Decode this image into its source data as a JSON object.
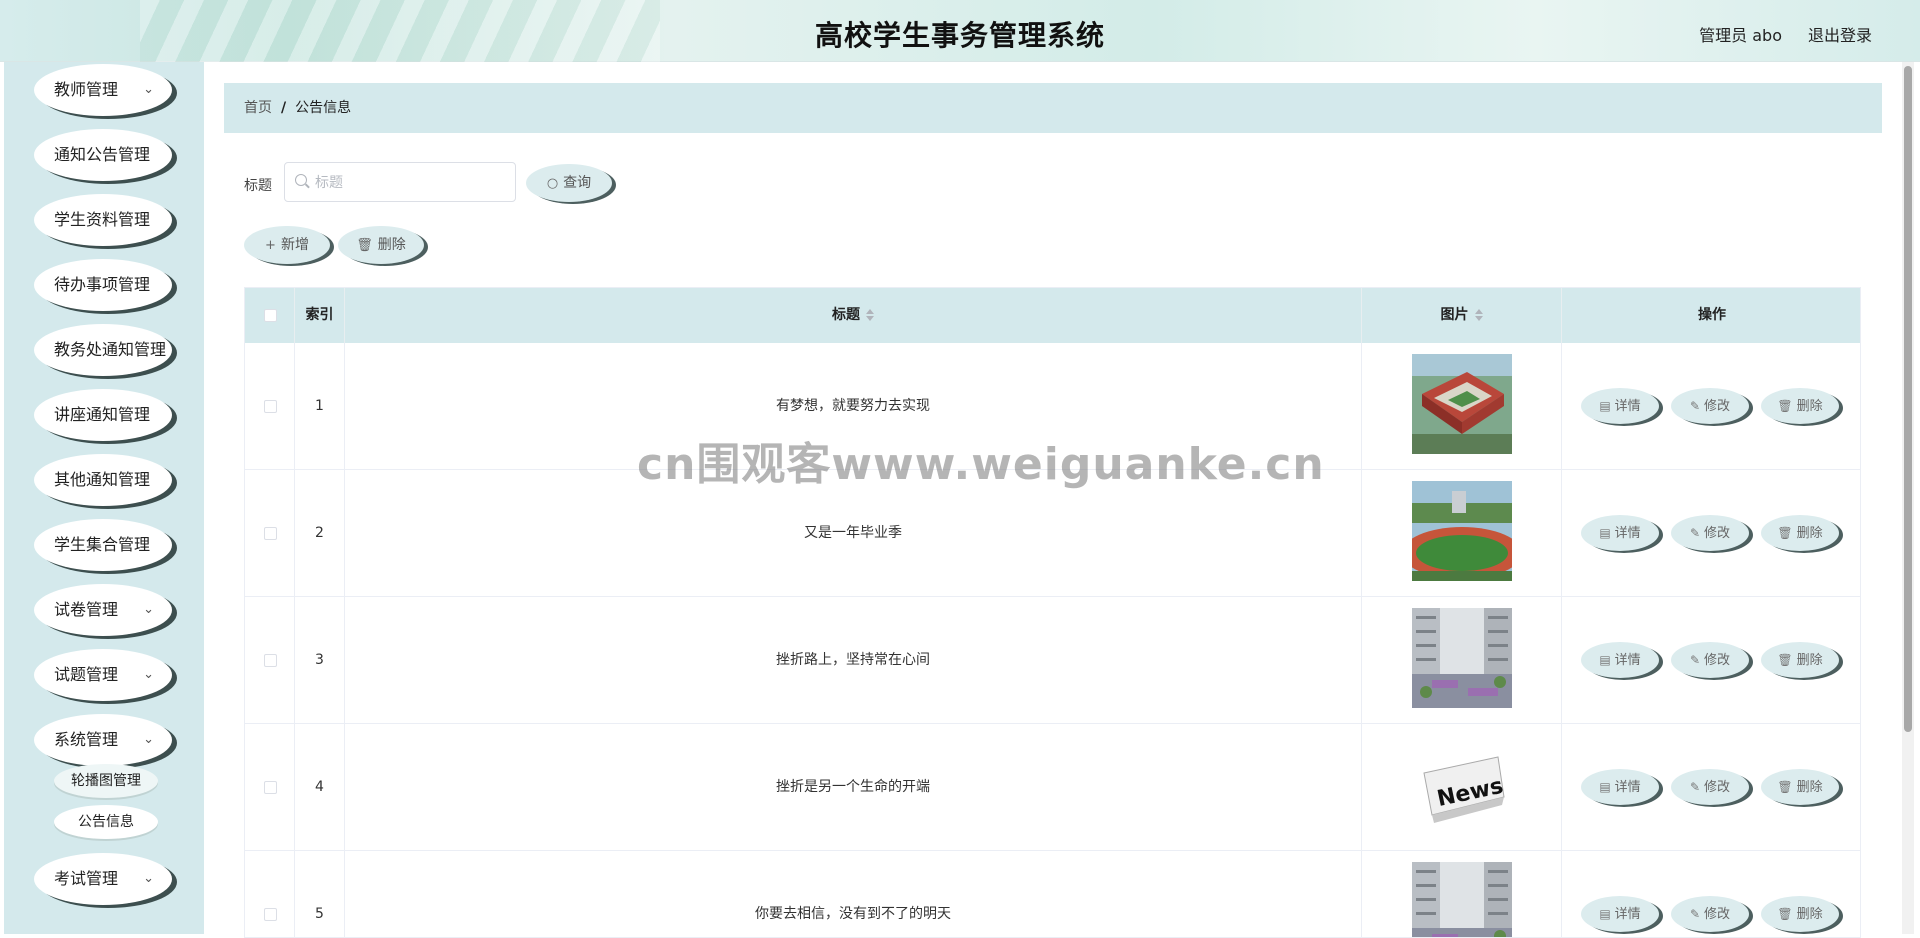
{
  "header": {
    "title": "高校学生事务管理系统",
    "user": "管理员 abo",
    "logout": "退出登录"
  },
  "sidebar": {
    "items": [
      {
        "label": "教师管理",
        "chevron": true
      },
      {
        "label": "通知公告管理",
        "chevron": false
      },
      {
        "label": "学生资料管理",
        "chevron": false
      },
      {
        "label": "待办事项管理",
        "chevron": false
      },
      {
        "label": "教务处通知管理",
        "chevron": false
      },
      {
        "label": "讲座通知管理",
        "chevron": false
      },
      {
        "label": "其他通知管理",
        "chevron": false
      },
      {
        "label": "学生集合管理",
        "chevron": false
      },
      {
        "label": "试卷管理",
        "chevron": true
      },
      {
        "label": "试题管理",
        "chevron": true
      },
      {
        "label": "系统管理",
        "chevron": true
      }
    ],
    "sub_items": [
      "轮播图管理",
      "公告信息"
    ],
    "last_item": {
      "label": "考试管理",
      "chevron": true
    },
    "chevron_glyph": "⌄"
  },
  "breadcrumb": {
    "home": "首页",
    "separator": "/",
    "current": "公告信息"
  },
  "search": {
    "label": "标题",
    "placeholder": "标题",
    "button": "查询"
  },
  "toolbar": {
    "add": "新增",
    "delete": "删除"
  },
  "table": {
    "headers": {
      "index": "索引",
      "title": "标题",
      "image": "图片",
      "actions": "操作"
    },
    "rows": [
      {
        "index": "1",
        "title": "有梦想，就要努力去实现",
        "image": "campus-aerial"
      },
      {
        "index": "2",
        "title": "又是一年毕业季",
        "image": "running-track"
      },
      {
        "index": "3",
        "title": "挫折路上，坚持常在心间",
        "image": "campus-courtyard"
      },
      {
        "index": "4",
        "title": "挫折是另一个生命的开端",
        "image": "news-paper"
      },
      {
        "index": "5",
        "title": "你要去相信，没有到不了的明天",
        "image": "campus-courtyard"
      }
    ],
    "row_actions": {
      "detail": "详情",
      "edit": "修改",
      "delete": "删除"
    }
  },
  "watermark": "cn围观客www.weiguanke.cn"
}
